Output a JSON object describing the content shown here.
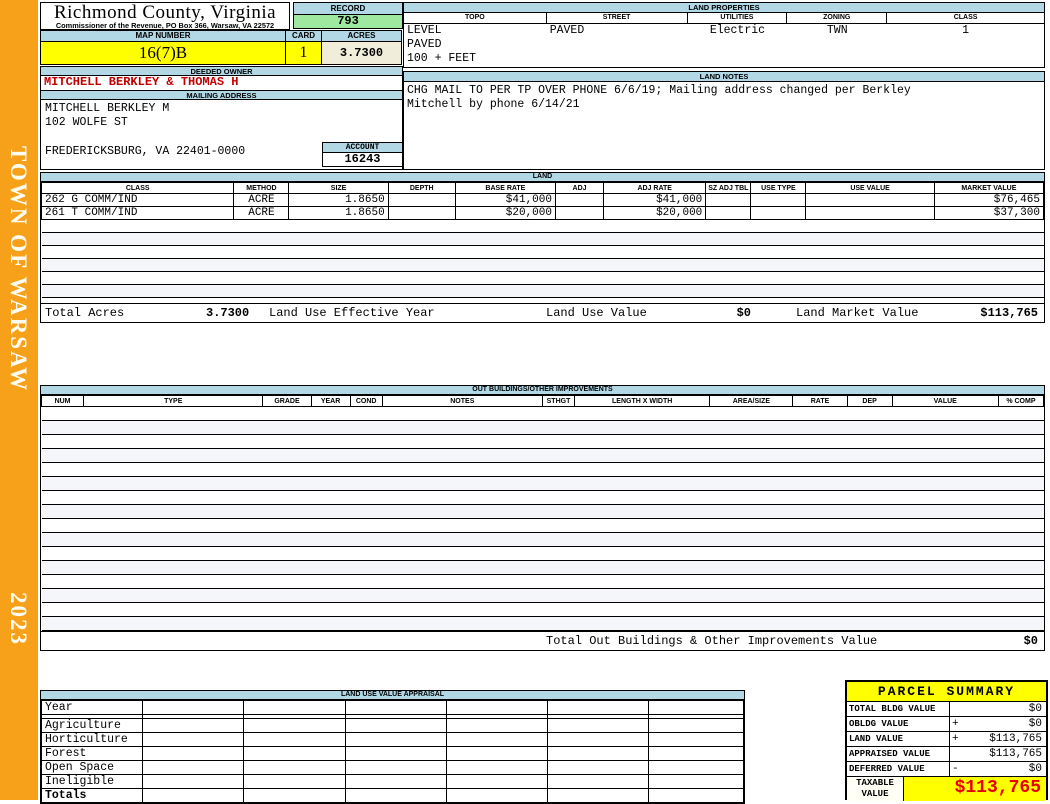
{
  "sidebar": {
    "org": "TOWN OF WARSAW",
    "year": "2023"
  },
  "header": {
    "title": "Richmond County, Virginia",
    "subtitle": "Commissioner of the Revenue, PO Box 366, Warsaw, VA 22572"
  },
  "record": {
    "label": "RECORD",
    "value": "793"
  },
  "map_number": {
    "label": "MAP NUMBER",
    "value": "16(7)B"
  },
  "card": {
    "label": "CARD",
    "value": "1"
  },
  "acres": {
    "label": "ACRES",
    "value": "3.7300"
  },
  "land_properties": {
    "title": "LAND PROPERTIES",
    "columns": [
      "TOPO",
      "STREET",
      "UTILITIES",
      "ZONING",
      "CLASS"
    ],
    "values": {
      "topo": [
        "LEVEL",
        "PAVED",
        "100 + FEET"
      ],
      "street": "PAVED",
      "utilities": "Electric",
      "zoning": "TWN",
      "class": "1"
    }
  },
  "owner": {
    "deeded_owner_label": "DEEDED OWNER",
    "deeded_owner": "MITCHELL BERKLEY & THOMAS H",
    "mailing_address_label": "MAILING ADDRESS",
    "address_lines": [
      "MITCHELL BERKLEY M",
      "102 WOLFE ST",
      "",
      "FREDERICKSBURG, VA 22401-0000"
    ],
    "account_label": "ACCOUNT",
    "account": "16243"
  },
  "land_notes": {
    "title": "LAND NOTES",
    "line1": "CHG MAIL TO PER TP OVER PHONE 6/6/19; Mailing address changed per Berkley",
    "line2": "Mitchell by phone 6/14/21"
  },
  "land": {
    "title": "LAND",
    "columns": [
      "CLASS",
      "METHOD",
      "SIZE",
      "DEPTH",
      "BASE RATE",
      "ADJ",
      "ADJ RATE",
      "SZ ADJ TBL",
      "USE TYPE",
      "USE VALUE",
      "MARKET VALUE"
    ],
    "rows": [
      [
        "262 G COMM/IND",
        "ACRE",
        "1.8650",
        "",
        "$41,000",
        "",
        "$41,000",
        "",
        "",
        "",
        "$76,465"
      ],
      [
        "261 T COMM/IND",
        "ACRE",
        "1.8650",
        "",
        "$20,000",
        "",
        "$20,000",
        "",
        "",
        "",
        "$37,300"
      ]
    ],
    "empty_rows": 6,
    "totals": {
      "total_acres_label": "Total Acres",
      "total_acres": "3.7300",
      "effective_year_label": "Land Use Effective Year",
      "use_value_label": "Land Use Value",
      "use_value": "$0",
      "market_value_label": "Land Market Value",
      "market_value": "$113,765"
    }
  },
  "out_buildings": {
    "title": "OUT BUILDINGS/OTHER IMPROVEMENTS",
    "columns": [
      "NUM",
      "TYPE",
      "GRADE",
      "YEAR",
      "COND",
      "NOTES",
      "STHGT",
      "LENGTH X WIDTH",
      "AREA/SIZE",
      "RATE",
      "DEP",
      "VALUE",
      "% COMP"
    ],
    "empty_rows": 16,
    "total_label": "Total Out Buildings & Other Improvements Value",
    "total_value": "$0"
  },
  "land_use_appraisal": {
    "title": "LAND USE VALUE APPRAISAL",
    "row_labels": [
      "Year",
      "Agriculture",
      "Horticulture",
      "Forest",
      "Open Space",
      "Ineligible",
      "Totals"
    ],
    "data_columns": 6
  },
  "parcel_summary": {
    "title": "PARCEL SUMMARY",
    "rows": [
      {
        "label": "TOTAL BLDG VALUE",
        "op": "",
        "value": "$0"
      },
      {
        "label": "OBLDG VALUE",
        "op": "+",
        "value": "$0"
      },
      {
        "label": "LAND VALUE",
        "op": "+",
        "value": "$113,765"
      },
      {
        "label": "APPRAISED VALUE",
        "op": "",
        "value": "$113,765"
      },
      {
        "label": "DEFERRED VALUE",
        "op": "-",
        "value": "$0"
      }
    ],
    "taxable": {
      "label_line1": "TAXABLE",
      "label_line2": "VALUE",
      "value": "$113,765"
    }
  },
  "colors": {
    "accent_orange": "#F7A11B",
    "section_header_blue": "#B2D8E6",
    "record_green": "#9FE89F",
    "highlight_yellow": "#FFFF00",
    "acres_cream": "#F0EDDA",
    "owner_red": "#C00000",
    "taxable_red": "#E80000"
  }
}
